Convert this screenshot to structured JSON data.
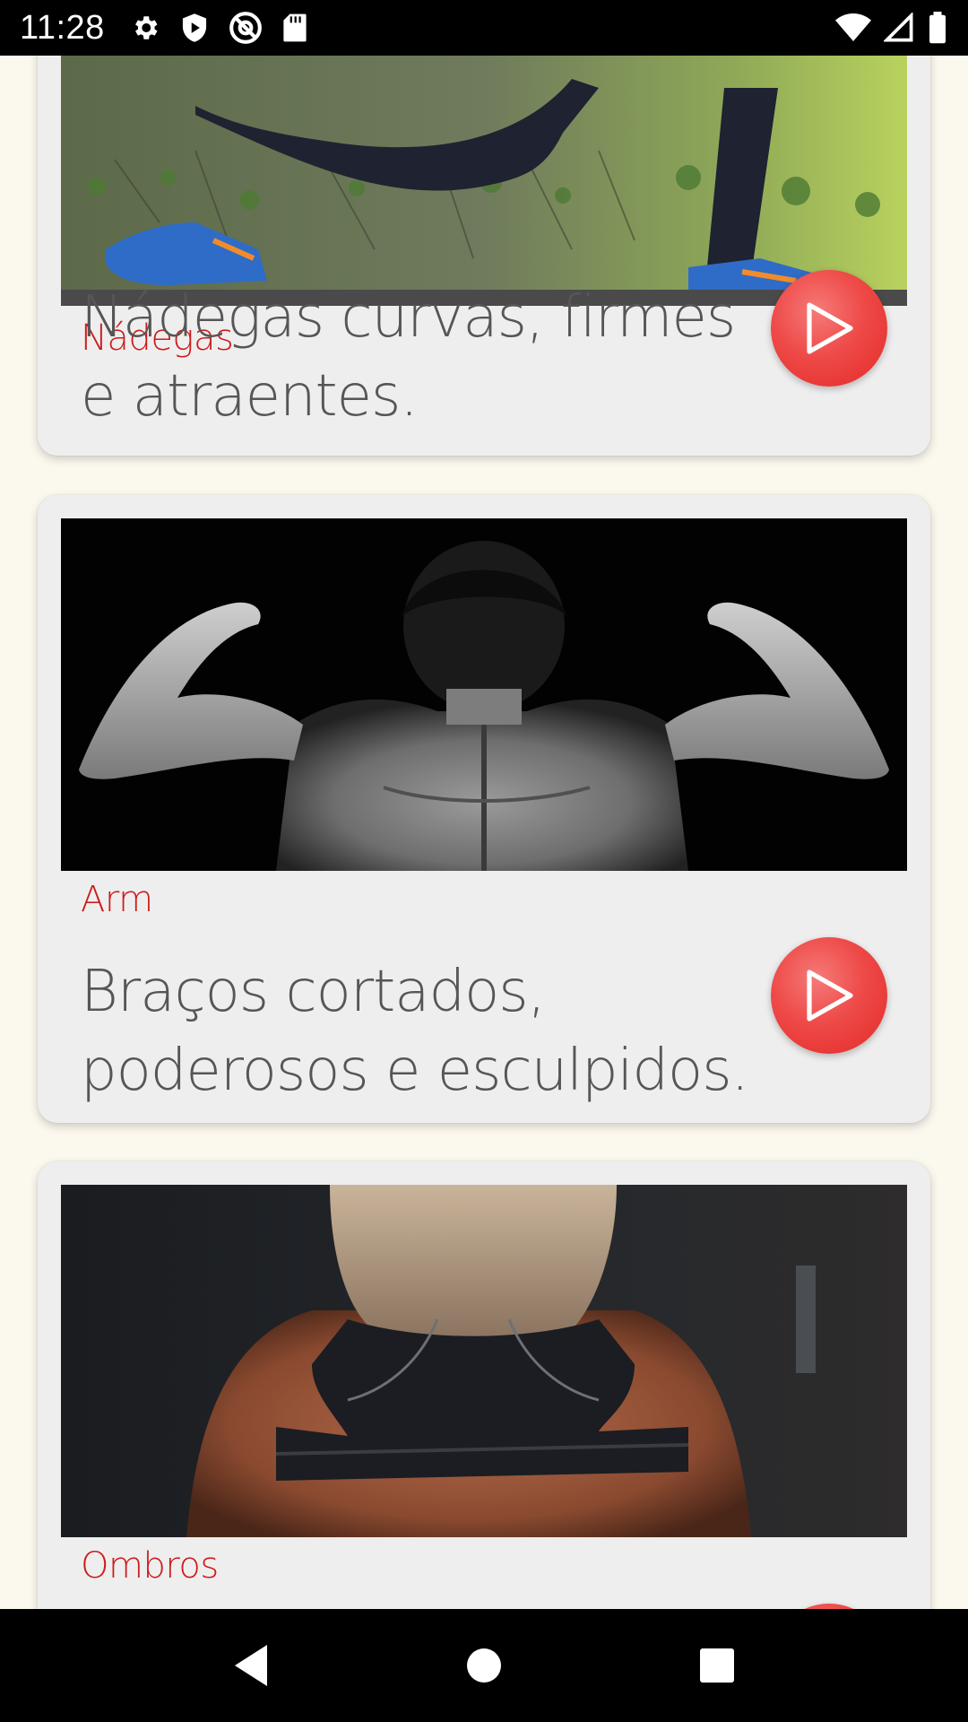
{
  "status_bar": {
    "time": "11:28",
    "left_icons": [
      "gear-icon",
      "shield-play-icon",
      "at-sign-icon",
      "sd-card-icon"
    ],
    "right_icons": [
      "wifi-icon",
      "cell-signal-icon",
      "battery-icon"
    ]
  },
  "cards": [
    {
      "category": "Nádegas",
      "title": "Nádegas curvas, firmes e atraentes.",
      "image": "legs-lunge-photo",
      "action_icon": "play-icon"
    },
    {
      "category": "Arm",
      "title": "Braços cortados, poderosos e esculpidos.",
      "image": "arms-flex-back-photo",
      "action_icon": "play-icon"
    },
    {
      "category": "Ombros",
      "title": "",
      "image": "woman-back-shoulders-photo",
      "action_icon": "play-icon"
    }
  ],
  "nav_bar": {
    "buttons": [
      "back-icon",
      "home-icon",
      "recents-icon"
    ]
  },
  "colors": {
    "background": "#fbf8ee",
    "card": "#efeeee",
    "category_text": "#cc1d1d",
    "title_text": "#565656",
    "play_button": "#e83a37"
  }
}
